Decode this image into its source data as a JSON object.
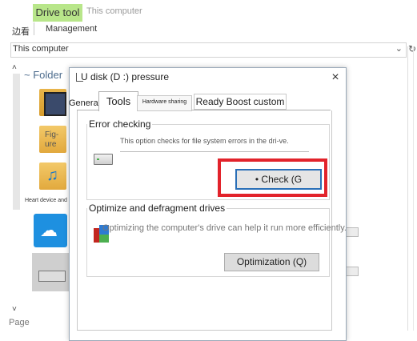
{
  "ribbon": {
    "tab_label": "Drive tool",
    "title_text": "This computer",
    "sub_label": "边看",
    "management_label": "Management"
  },
  "address_bar": {
    "value": "This computer",
    "dropdown_icon": "chevron-down-icon",
    "refresh_icon": "refresh-icon"
  },
  "left_pane": {
    "folder_header": "~ Folder",
    "pictures_caption": "Fig-\nure",
    "heart_caption": "Heart device and",
    "page_label": "Page"
  },
  "dialog": {
    "title": "U disk (D :) pressure",
    "close_glyph": "×",
    "tabs": {
      "general": "General",
      "tools": "Tools",
      "hardware": "Hardware sharing",
      "ready_boost": "Ready Boost custom"
    },
    "error_checking": {
      "heading": "Error checking",
      "description": "This option checks for file system errors in the dri-ve.",
      "button_label": "• Check (G"
    },
    "optimize": {
      "heading": "Optimize and defragment drives",
      "description": "Optimizing the computer's drive can help it run more efficiently.",
      "button_label": "Optimization (Q)"
    }
  },
  "colors": {
    "ribbon_tab": "#b8e68a",
    "highlight_box": "#e2232b",
    "focus_border": "#2a6fb7"
  }
}
